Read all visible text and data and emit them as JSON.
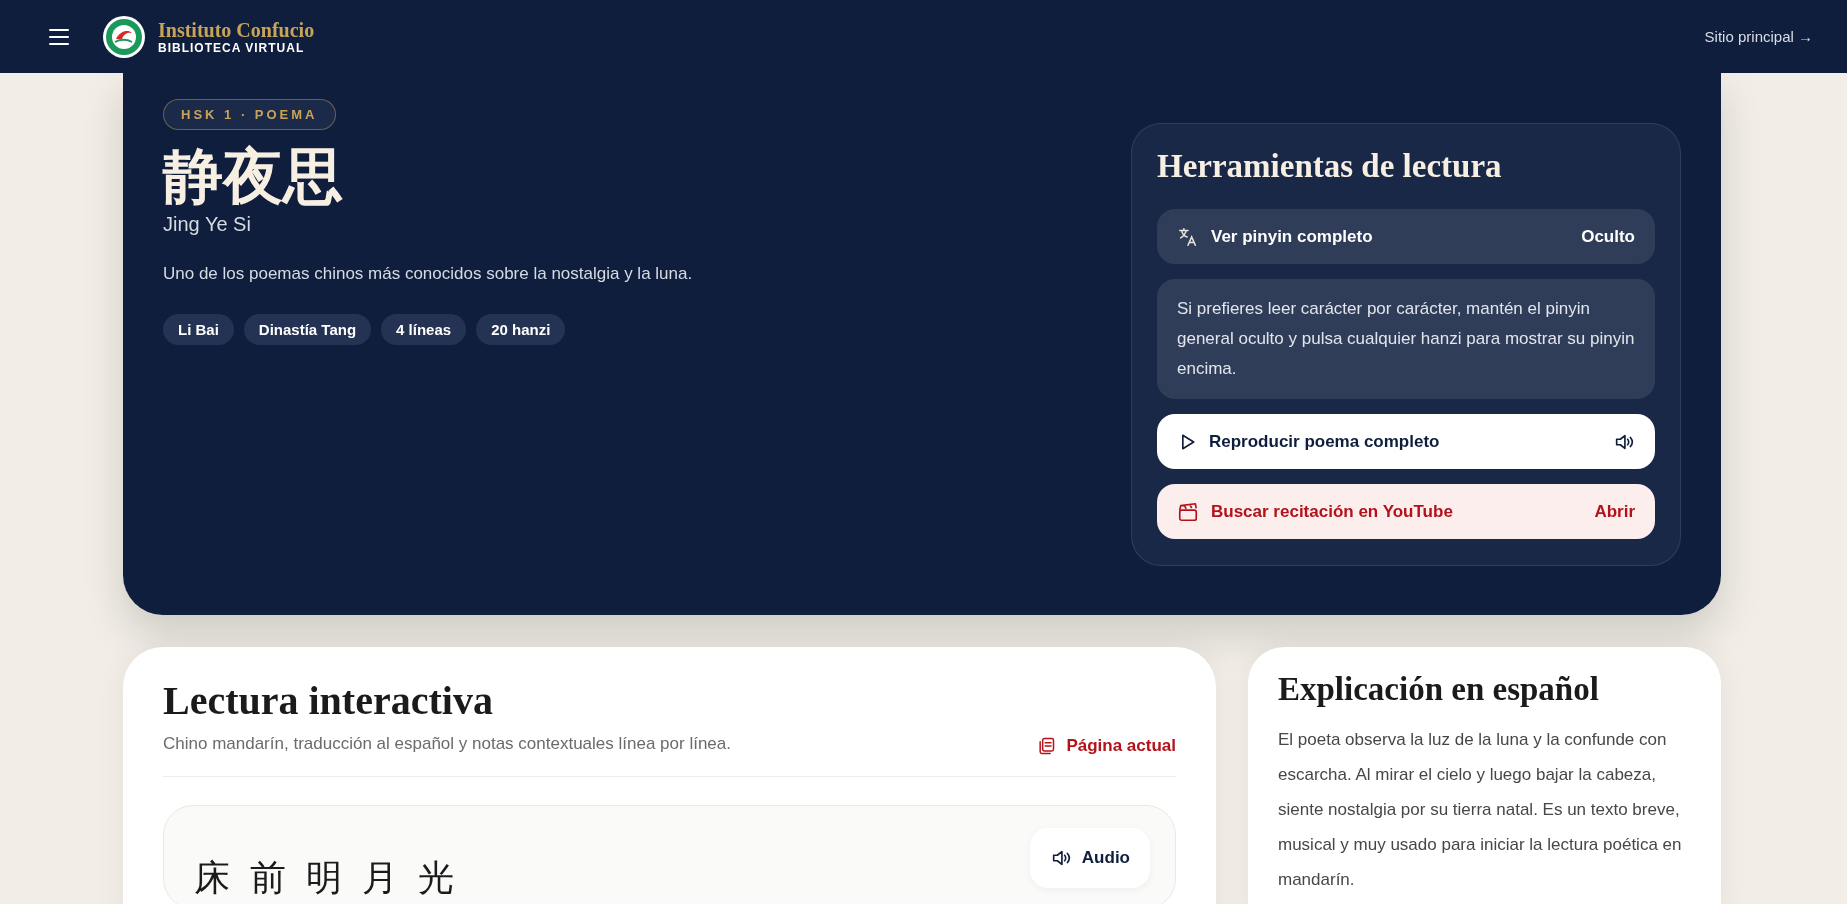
{
  "header": {
    "brand_title": "Instituto Confucio",
    "brand_subtitle": "BIBLIOTECA VIRTUAL",
    "link": "Sitio principal →"
  },
  "hero": {
    "tag": "HSK 1 · POEMA",
    "title": "静夜思",
    "pinyin": "Jing Ye Si",
    "description": "Uno de los poemas chinos más conocidos sobre la nostalgia y la luna.",
    "chips": [
      "Li Bai",
      "Dinastía Tang",
      "4 líneas",
      "20 hanzi"
    ]
  },
  "tools": {
    "title": "Herramientas de lectura",
    "pinyin_toggle": {
      "label": "Ver pinyin completo",
      "status": "Oculto",
      "on": false
    },
    "hint": "Si prefieres leer carácter por carácter, mantén el pinyin general oculto y pulsa cualquier hanzi para mostrar su pinyin encima.",
    "actions": [
      {
        "kind": "play",
        "label": "Reproducir poema completo"
      },
      {
        "kind": "video",
        "label": "Buscar recitación en YouTube",
        "trailing": "Abrir"
      }
    ]
  },
  "reading": {
    "title": "Lectura interactiva",
    "subtitle": "Chino mandarín, traducción al español y notas contextuales línea por línea.",
    "page_link": "Página actual",
    "lines": [
      {
        "audio": "Audio",
        "hanzi": [
          "床",
          "前",
          "明",
          "月",
          "光"
        ]
      }
    ]
  },
  "explanation": {
    "title": "Explicación en español",
    "text": "El poeta observa la luz de la luna y la confunde con escarcha. Al mirar el cielo y luego bajar la cabeza, siente nostalgia por su tierra natal. Es un texto breve, musical y muy usado para iniciar la lectura poética en mandarín."
  }
}
